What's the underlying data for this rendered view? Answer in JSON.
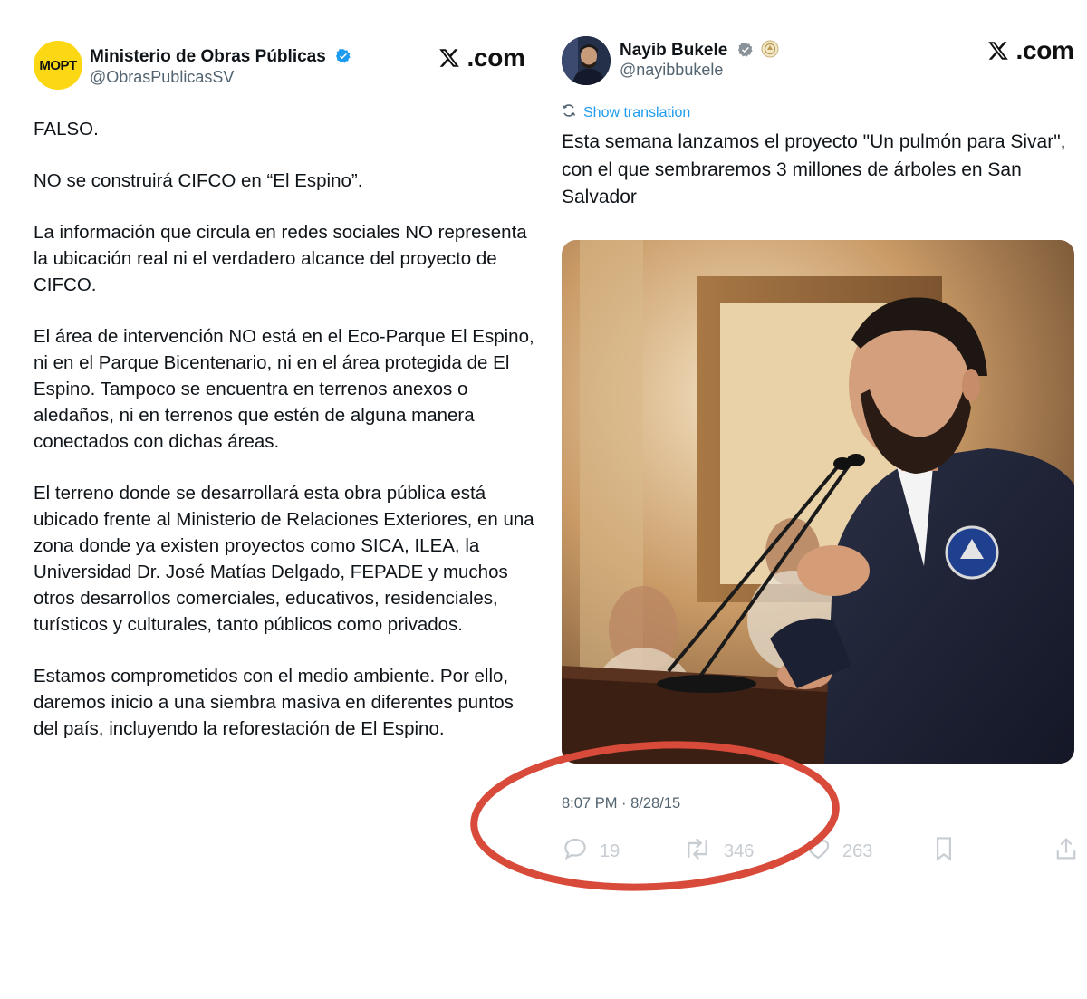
{
  "left_tweet": {
    "avatar_text": "MOPT",
    "author_name": "Ministerio de Obras Públicas",
    "handle": "@ObrasPublicasSV",
    "source_label": ".com",
    "paragraphs": [
      "FALSO.",
      "NO se construirá CIFCO en “El Espino”.",
      "La información que circula en redes sociales NO representa la ubicación real ni el verdadero alcance del proyecto de CIFCO.",
      "El área de intervención NO está en el Eco-Parque El Espino, ni en el Parque Bicentenario, ni en el área protegida de El Espino. Tampoco se encuentra en terrenos anexos o aledaños, ni en terrenos que estén de alguna manera conectados con dichas áreas.",
      "El terreno donde se desarrollará esta obra pública está ubicado frente al Ministerio de Relaciones Exteriores, en una zona donde ya existen proyectos como SICA, ILEA, la Universidad Dr. José Matías Delgado, FEPADE y muchos otros desarrollos comerciales, educativos, residenciales, turísticos y culturales, tanto públicos como privados.",
      "Estamos comprometidos con el medio ambiente. Por ello, daremos inicio a una siembra masiva en diferentes puntos del país, incluyendo la reforestación de El Espino."
    ]
  },
  "right_tweet": {
    "author_name": "Nayib Bukele",
    "handle": "@nayibbukele",
    "source_label": ".com",
    "show_translation": "Show translation",
    "text": "Esta semana lanzamos el proyecto \"Un pulmón para Sivar\", con el que sembraremos 3 millones de árboles en San Salvador",
    "timestamp": "8:07 PM · 8/28/15",
    "actions": {
      "replies": "19",
      "reposts": "346",
      "likes": "263"
    }
  },
  "colors": {
    "verified_blue": "#1d9bf0",
    "annotation_red": "#d84a3a",
    "mopt_yellow": "#fcd814"
  }
}
